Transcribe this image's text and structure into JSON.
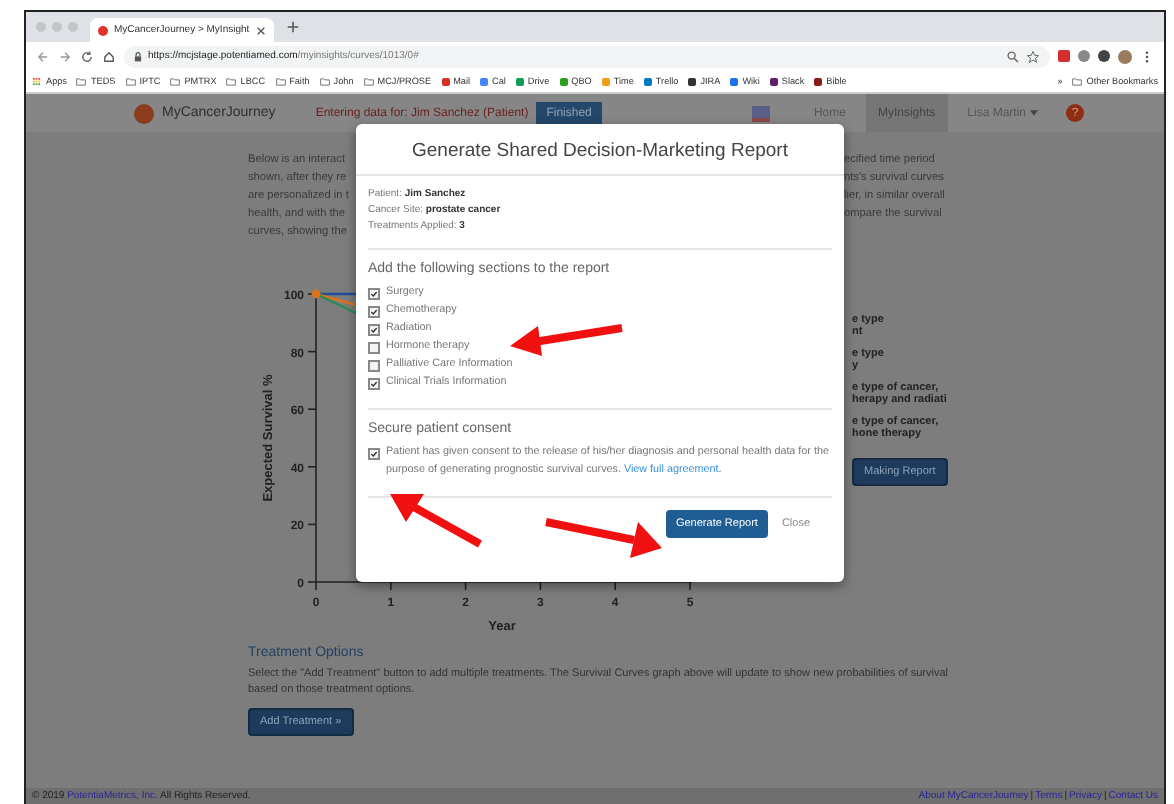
{
  "browser": {
    "tab_title": "MyCancerJourney > MyInsight",
    "url_host": "https://mcjstage.potentiamed.com",
    "url_path": "/myinsights/curves/1013/0#",
    "bookmarks": [
      {
        "kind": "apps",
        "label": "Apps"
      },
      {
        "kind": "folder",
        "label": "TEDS"
      },
      {
        "kind": "folder",
        "label": "IPTC"
      },
      {
        "kind": "folder",
        "label": "PMTRX"
      },
      {
        "kind": "folder",
        "label": "LBCC"
      },
      {
        "kind": "folder",
        "label": "Faith"
      },
      {
        "kind": "folder",
        "label": "John"
      },
      {
        "kind": "folder",
        "label": "MCJ/PROSE"
      },
      {
        "kind": "site",
        "label": "Mail",
        "color": "#d93025"
      },
      {
        "kind": "site",
        "label": "Cal",
        "color": "#4285f4"
      },
      {
        "kind": "site",
        "label": "Drive",
        "color": "#0f9d58"
      },
      {
        "kind": "site",
        "label": "QBO",
        "color": "#2ca01c"
      },
      {
        "kind": "site",
        "label": "Time",
        "color": "#f39c12"
      },
      {
        "kind": "site",
        "label": "Trello",
        "color": "#0079bf"
      },
      {
        "kind": "site",
        "label": "JIRA",
        "color": "#333333"
      },
      {
        "kind": "site",
        "label": "Wiki",
        "color": "#1a73e8"
      },
      {
        "kind": "site",
        "label": "Slack",
        "color": "#611f69"
      },
      {
        "kind": "site",
        "label": "Bible",
        "color": "#8b1a1a"
      }
    ],
    "more": "»",
    "other_bookmarks": "Other Bookmarks"
  },
  "navbar": {
    "brand": "MyCancerJourney",
    "entering": "Entering data for: Jim Sanchez (Patient)",
    "finished": "Finished",
    "tabs": [
      {
        "label": "Home",
        "selected": false
      },
      {
        "label": "MyInsights",
        "selected": true
      }
    ],
    "user": "Lisa Martin",
    "help": "?"
  },
  "intro_left": [
    "Below is an interact",
    "shown, after they re",
    "are personalized in t",
    "health, and with the",
    "curves, showing the"
  ],
  "intro_right": [
    "ecified time period",
    "nts's survival curves",
    "lier, in similar overall",
    "ompare the survival"
  ],
  "chart": {
    "ylabel": "Expected Survival %",
    "xlabel": "Year",
    "yticks": [
      "100",
      "80",
      "60",
      "40",
      "20",
      "0"
    ],
    "xticks": [
      "0",
      "1",
      "2",
      "3",
      "4",
      "5"
    ]
  },
  "legend": [
    [
      "e type",
      "nt"
    ],
    [
      "e type",
      "y"
    ],
    [
      "e type of cancer,",
      "herapy and radiati"
    ],
    [
      "e type of cancer,",
      "hone therapy"
    ]
  ],
  "making_report": "Making Report",
  "treatment": {
    "heading": "Treatment Options",
    "text": "Select the \"Add Treatment\" button to add multiple treatments. The Survival Curves graph above will update to show new probabilities of survival based on those treatment options.",
    "button": "Add Treatment »"
  },
  "footer": {
    "copyright_prefix": "© 2019",
    "company": "PotentiaMetrics, Inc.",
    "copyright_suffix": "All Rights Reserved.",
    "links": [
      {
        "kind": "link",
        "text": "About MyCancerJourney"
      },
      {
        "kind": "separator",
        "text": "|"
      },
      {
        "kind": "link",
        "text": "Terms"
      },
      {
        "kind": "separator",
        "text": "|"
      },
      {
        "kind": "link",
        "text": "Privacy"
      },
      {
        "kind": "separator",
        "text": "|"
      },
      {
        "kind": "link",
        "text": "Contact Us"
      }
    ]
  },
  "modal": {
    "title": "Generate Shared Decision-Marketing Report",
    "info": [
      {
        "label": "Patient:",
        "value": "Jim Sanchez"
      },
      {
        "label": "Cancer Site:",
        "value": "prostate cancer"
      },
      {
        "label": "Treatments Applied:",
        "value": "3"
      }
    ],
    "sections_heading": "Add the following sections to the report",
    "sections": [
      {
        "label": "Surgery",
        "checked": true
      },
      {
        "label": "Chemotherapy",
        "checked": true
      },
      {
        "label": "Radiation",
        "checked": true
      },
      {
        "label": "Hormone therapy",
        "checked": false
      },
      {
        "label": "Palliative Care Information",
        "checked": false
      },
      {
        "label": "Clinical Trials Information",
        "checked": true
      }
    ],
    "consent_heading": "Secure patient consent",
    "consent": {
      "checked": true,
      "text": "Patient has given consent to the release of his/her diagnosis and personal health data for the purpose of generating prognostic survival curves.",
      "link": "View full agreement."
    },
    "primary": "Generate Report",
    "close": "Close"
  }
}
